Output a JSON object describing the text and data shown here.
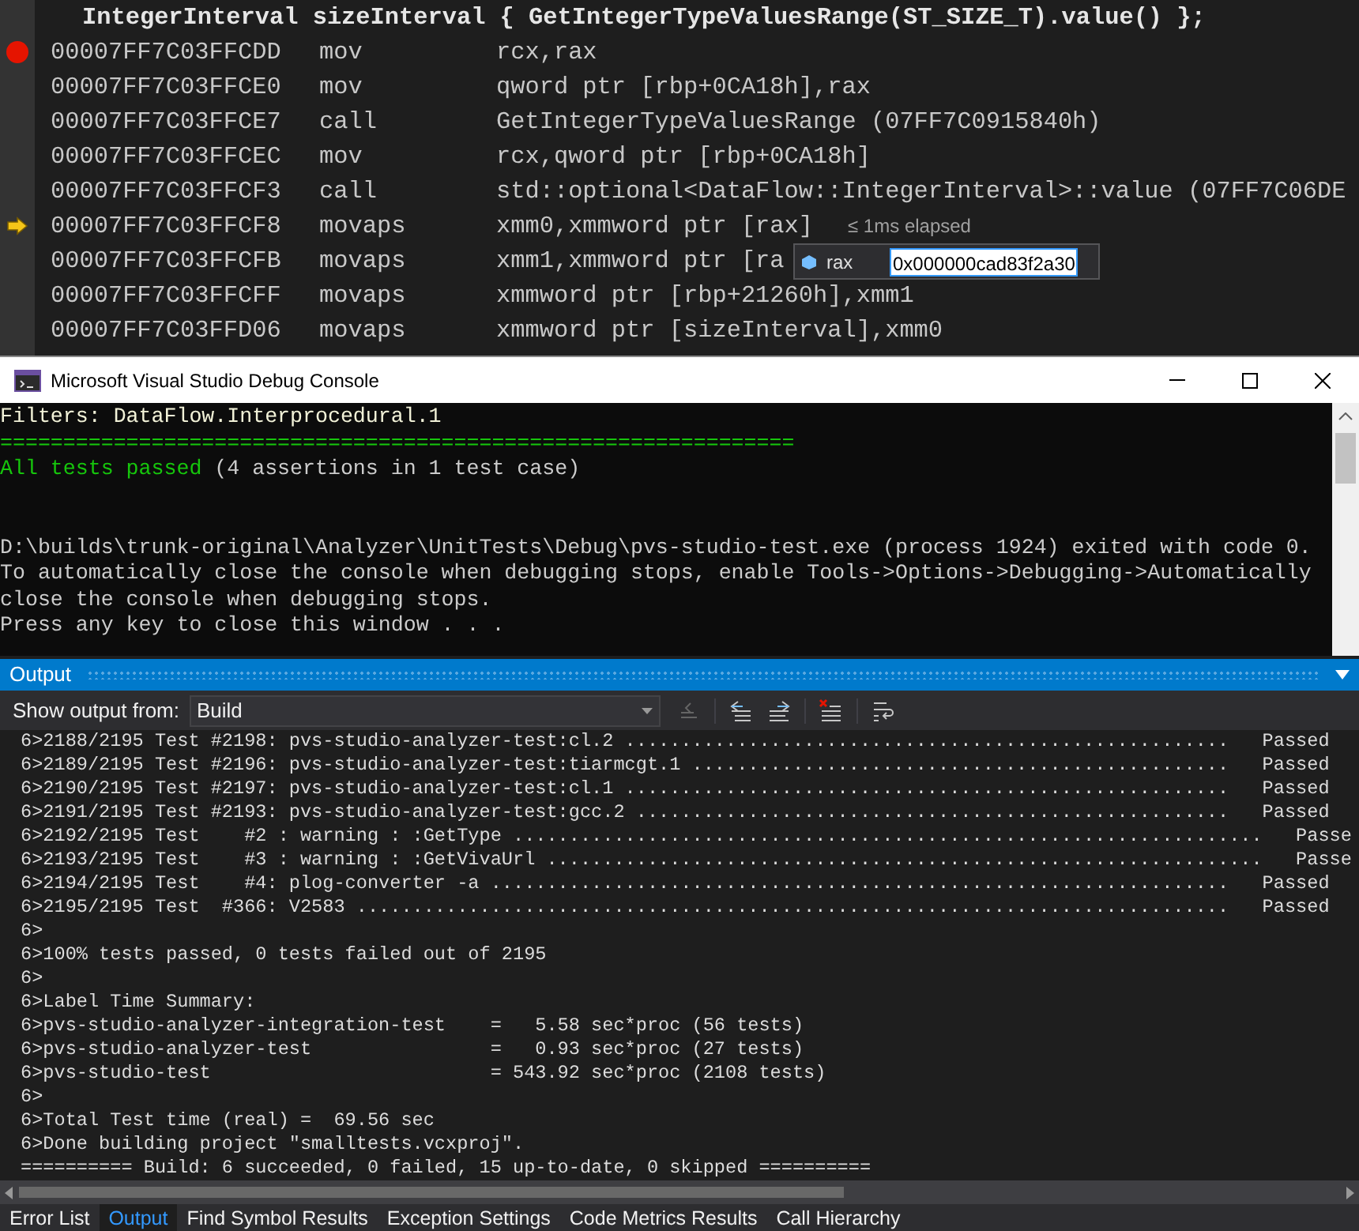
{
  "disassembly": {
    "source_line": "IntegerInterval sizeInterval { GetIntegerTypeValuesRange(ST_SIZE_T).value() };",
    "rows": [
      {
        "kind": "breakpoint",
        "address": "00007FF7C03FFCDD",
        "mnemonic": "mov",
        "operands": "rcx,rax"
      },
      {
        "kind": "plain",
        "address": "00007FF7C03FFCE0",
        "mnemonic": "mov",
        "operands": "qword ptr [rbp+0CA18h],rax"
      },
      {
        "kind": "plain",
        "address": "00007FF7C03FFCE7",
        "mnemonic": "call",
        "operands": "GetIntegerTypeValuesRange (07FF7C0915840h)"
      },
      {
        "kind": "plain",
        "address": "00007FF7C03FFCEC",
        "mnemonic": "mov",
        "operands": "rcx,qword ptr [rbp+0CA18h]"
      },
      {
        "kind": "plain",
        "address": "00007FF7C03FFCF3",
        "mnemonic": "call",
        "operands": "std::optional<DataFlow::IntegerInterval>::value (07FF7C06DE"
      },
      {
        "kind": "current",
        "address": "00007FF7C03FFCF8",
        "mnemonic": "movaps",
        "operands": "xmm0,xmmword ptr [rax]",
        "note": "≤ 1ms elapsed"
      },
      {
        "kind": "plain",
        "address": "00007FF7C03FFCFB",
        "mnemonic": "movaps",
        "operands": "xmm1,xmmword ptr [ra"
      },
      {
        "kind": "plain",
        "address": "00007FF7C03FFCFF",
        "mnemonic": "movaps",
        "operands": "xmmword ptr [rbp+21260h],xmm1"
      },
      {
        "kind": "plain",
        "address": "00007FF7C03FFD06",
        "mnemonic": "movaps",
        "operands": "xmmword ptr [sizeInterval],xmm0"
      }
    ],
    "datatip": {
      "name": "rax",
      "value": "0x000000cad83f2a30"
    }
  },
  "console": {
    "title": "Microsoft Visual Studio Debug Console",
    "header_lines": [
      [
        {
          "text": "Filters: DataFlow.Interprocedural.1",
          "color": "#f2f2d8"
        }
      ],
      [
        {
          "text": "===============================================================",
          "color": "#16c60c"
        }
      ],
      [
        {
          "text": "All tests passed",
          "color": "#16c60c"
        },
        {
          "text": " (4 assertions in 1 test case)",
          "color": "#cccccc"
        }
      ]
    ],
    "message_lines": [
      "D:\\builds\\trunk-original\\Analyzer\\UnitTests\\Debug\\pvs-studio-test.exe (process 1924) exited with code 0.",
      "To automatically close the console when debugging stops, enable Tools->Options->Debugging->Automatically",
      "close the console when debugging stops.",
      "Press any key to close this window . . ."
    ]
  },
  "output": {
    "title": "Output",
    "show_from_label": "Show output from:",
    "source": "Build",
    "lines": [
      "6>2188/2195 Test #2198: pvs-studio-analyzer-test:cl.2 ......................................................   Passed",
      "6>2189/2195 Test #2196: pvs-studio-analyzer-test:tiarmcgt.1 ................................................   Passed",
      "6>2190/2195 Test #2197: pvs-studio-analyzer-test:cl.1 ......................................................   Passed",
      "6>2191/2195 Test #2193: pvs-studio-analyzer-test:gcc.2 .....................................................   Passed",
      "6>2192/2195 Test    #2 : warning : :GetType ...................................................................   Passe",
      "6>2193/2195 Test    #3 : warning : :GetVivaUrl ................................................................   Passe",
      "6>2194/2195 Test    #4: plog-converter -a ..................................................................   Passed",
      "6>2195/2195 Test  #366: V2583 ..............................................................................   Passed",
      "6>",
      "6>100% tests passed, 0 tests failed out of 2195",
      "6>",
      "6>Label Time Summary:",
      "6>pvs-studio-analyzer-integration-test    =   5.58 sec*proc (56 tests)",
      "6>pvs-studio-analyzer-test                =   0.93 sec*proc (27 tests)",
      "6>pvs-studio-test                         = 543.92 sec*proc (2108 tests)",
      "6>",
      "6>Total Test time (real) =  69.56 sec",
      "6>Done building project \"smalltests.vcxproj\".",
      "========== Build: 6 succeeded, 0 failed, 15 up-to-date, 0 skipped =========="
    ]
  },
  "tabs": [
    {
      "label": "Error List",
      "selected": false
    },
    {
      "label": "Output",
      "selected": true
    },
    {
      "label": "Find Symbol Results",
      "selected": false
    },
    {
      "label": "Exception Settings",
      "selected": false
    },
    {
      "label": "Code Metrics Results",
      "selected": false
    },
    {
      "label": "Call Hierarchy",
      "selected": false
    }
  ]
}
